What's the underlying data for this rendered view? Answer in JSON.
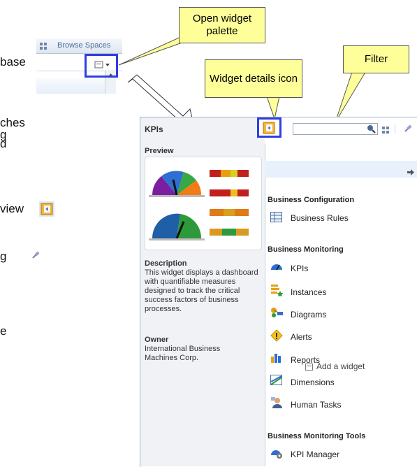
{
  "doc_fragments": [
    "base",
    "ches",
    "g",
    "d",
    "view",
    "g",
    "e"
  ],
  "browse_spaces": {
    "label": "Browse Spaces"
  },
  "callouts": {
    "open_palette": "Open widget palette",
    "filter": "Filter",
    "details_icon": "Widget details icon"
  },
  "add_widget": {
    "label": "Add a widget"
  },
  "panel": {
    "title": "KPIs",
    "preview_heading": "Preview",
    "description_heading": "Description",
    "description_text": "This widget displays a dashboard with quantifiable measures designed to track the critical success factors of business processes.",
    "owner_heading": "Owner",
    "owner_text": "International Business Machines Corp.",
    "categories": [
      {
        "title": "Business Configuration",
        "items": [
          {
            "label": "Business Rules",
            "icon": "table-icon"
          }
        ]
      },
      {
        "title": "Business Monitoring",
        "items": [
          {
            "label": "KPIs",
            "icon": "kpi-icon"
          },
          {
            "label": "Instances",
            "icon": "instances-icon"
          },
          {
            "label": "Diagrams",
            "icon": "diagrams-icon"
          },
          {
            "label": "Alerts",
            "icon": "alert-icon"
          },
          {
            "label": "Reports",
            "icon": "reports-icon"
          },
          {
            "label": "Dimensions",
            "icon": "dimensions-icon"
          },
          {
            "label": "Human Tasks",
            "icon": "human-tasks-icon"
          }
        ]
      },
      {
        "title": "Business Monitoring Tools",
        "items": [
          {
            "label": "KPI Manager",
            "icon": "kpi-manager-icon"
          }
        ]
      }
    ]
  },
  "colors": {
    "highlight": "#2e3fe0",
    "callout": "#ffff99",
    "panel_bg": "#f0f2f6"
  }
}
